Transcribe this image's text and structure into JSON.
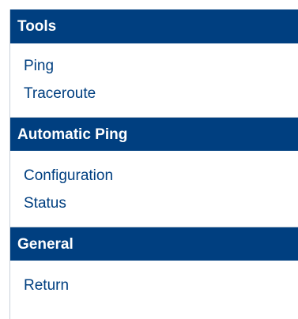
{
  "menu": {
    "sections": [
      {
        "title": "Tools",
        "items": [
          "Ping",
          "Traceroute"
        ]
      },
      {
        "title": "Automatic Ping",
        "items": [
          "Configuration",
          "Status"
        ]
      },
      {
        "title": "General",
        "items": [
          "Return"
        ]
      }
    ]
  },
  "colors": {
    "header_bg": "#003f80",
    "header_text": "#ffffff",
    "link_text": "#003f80"
  }
}
